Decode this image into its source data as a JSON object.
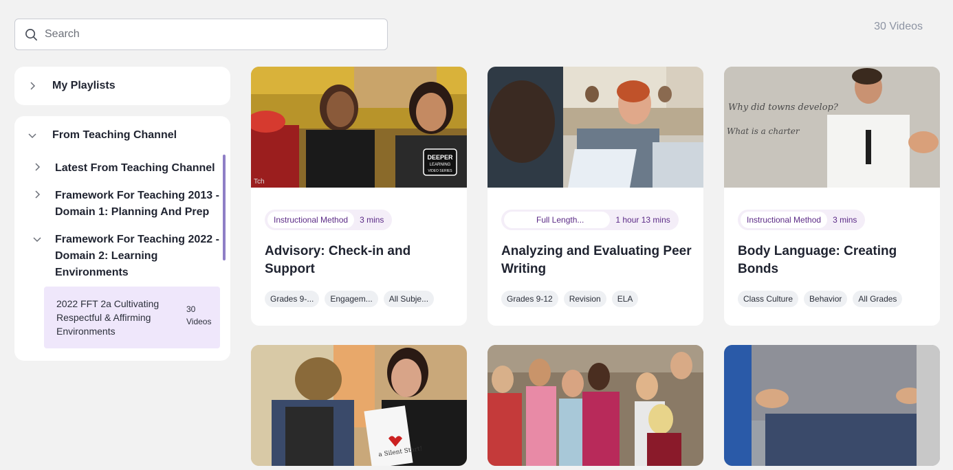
{
  "search": {
    "placeholder": "Search",
    "value": ""
  },
  "header": {
    "video_count": "30 Videos"
  },
  "sidebar": {
    "playlists": {
      "label": "My Playlists"
    },
    "channel": {
      "label": "From Teaching Channel",
      "items": [
        {
          "label": "Latest From Teaching Channel",
          "expanded": false
        },
        {
          "label": "Framework For Teaching 2013 - Domain 1: Planning And Prep",
          "expanded": false
        },
        {
          "label": "Framework For Teaching 2022 - Domain 2: Learning Environments",
          "expanded": true
        }
      ],
      "active": {
        "label": "2022 FFT 2a Cultivating Respectful & Affirming Environments",
        "count": "30 Videos"
      }
    }
  },
  "cards": [
    {
      "type": "Instructional Method",
      "duration": "3 mins",
      "title": "Advisory: Check-in and Support",
      "tags": [
        "Grades 9-...",
        "Engagem...",
        "All Subje..."
      ],
      "badge": "DEEPER LEARNING VIDEO SERIES",
      "watermark": "Tch"
    },
    {
      "type": "Full Length...",
      "duration": "1 hour 13 mins",
      "title": "Analyzing and Evaluating Peer Writing",
      "tags": [
        "Grades 9-12",
        "Revision",
        "ELA"
      ]
    },
    {
      "type": "Instructional Method",
      "duration": "3 mins",
      "title": "Body Language: Creating Bonds",
      "tags": [
        "Class Culture",
        "Behavior",
        "All Grades"
      ],
      "board_text": [
        "Why did towns develop?",
        "What is a charter"
      ]
    },
    {
      "thumb_text": "a Silent Start!"
    },
    {},
    {}
  ],
  "colors": {
    "background": "#f2f2f2",
    "accent_purple": "#5b2a86",
    "active_bg": "#efe7fb",
    "scroll_thumb": "#8f7fc6"
  }
}
